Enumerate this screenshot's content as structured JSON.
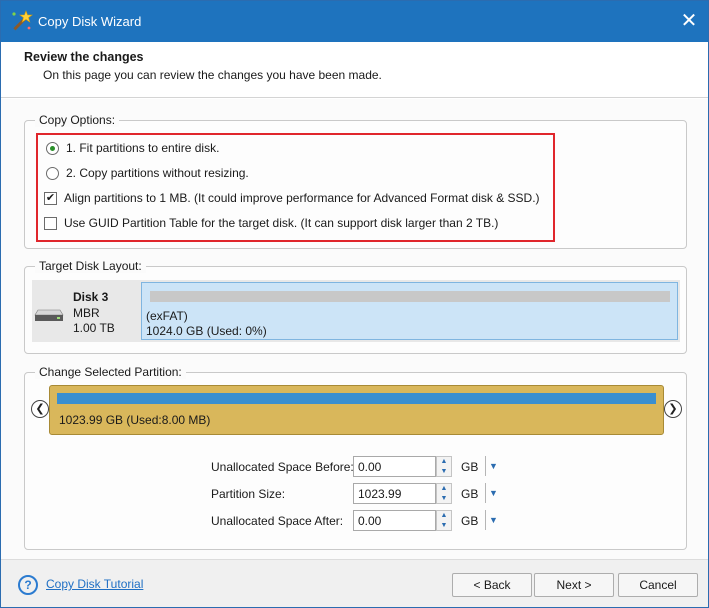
{
  "window": {
    "title": "Copy Disk Wizard",
    "close_glyph": "✕",
    "accent": "#1e73be"
  },
  "header": {
    "title": "Review the changes",
    "subtitle": "On this page you can review the changes you have been made."
  },
  "copy_options": {
    "label": "Copy Options:",
    "options": [
      {
        "type": "radio",
        "checked": true,
        "label": "1. Fit partitions to entire disk."
      },
      {
        "type": "radio",
        "checked": false,
        "label": "2. Copy partitions without resizing."
      },
      {
        "type": "checkbox",
        "checked": true,
        "label": "Align partitions to 1 MB.  (It could improve performance for Advanced Format disk & SSD.)"
      },
      {
        "type": "checkbox",
        "checked": false,
        "label": "Use GUID Partition Table for the target disk. (It can support disk larger than 2 TB.)"
      }
    ],
    "check_glyph": "✔"
  },
  "target_layout": {
    "label": "Target Disk Layout:",
    "disk_name": "Disk 3",
    "disk_type": "MBR",
    "disk_size": "1.00 TB",
    "partition_fs": "(exFAT)",
    "partition_info": "1024.0 GB (Used: 0%)"
  },
  "change_partition": {
    "label": "Change Selected Partition:",
    "left_arrow": "❮",
    "right_arrow": "❯",
    "partition_info": "1023.99 GB (Used:8.00 MB)",
    "fields": [
      {
        "label": "Unallocated Space Before:",
        "value": "0.00",
        "unit": "GB"
      },
      {
        "label": "Partition Size:",
        "value": "1023.99",
        "unit": "GB"
      },
      {
        "label": "Unallocated Space After:",
        "value": "0.00",
        "unit": "GB"
      }
    ],
    "spin_up": "▲",
    "spin_down": "▼",
    "drop_glyph": "▼"
  },
  "footer": {
    "help_glyph": "?",
    "tutorial_link": "Copy Disk Tutorial",
    "back_label": "< Back",
    "next_label": "Next >",
    "cancel_label": "Cancel"
  }
}
